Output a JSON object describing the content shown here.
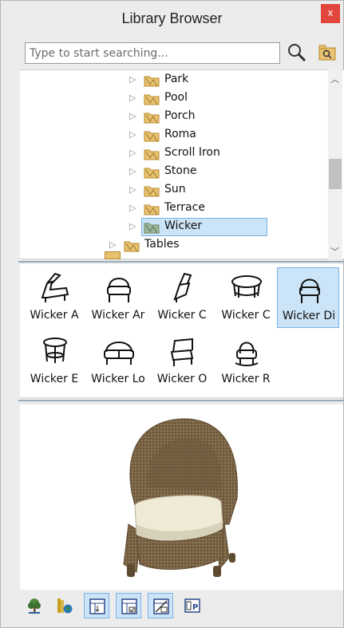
{
  "window": {
    "title": "Library Browser",
    "close_label": "x"
  },
  "search": {
    "placeholder": "Type to start searching...",
    "value": ""
  },
  "tree": {
    "items": [
      {
        "label": "Park"
      },
      {
        "label": "Pool"
      },
      {
        "label": "Porch"
      },
      {
        "label": "Roma"
      },
      {
        "label": "Scroll Iron"
      },
      {
        "label": "Stone"
      },
      {
        "label": "Sun"
      },
      {
        "label": "Terrace"
      },
      {
        "label": "Wicker",
        "selected": true
      }
    ],
    "parent_item": {
      "label": "Tables"
    }
  },
  "thumbnails": [
    {
      "label": "Wicker A"
    },
    {
      "label": "Wicker Ar"
    },
    {
      "label": "Wicker C"
    },
    {
      "label": "Wicker C"
    },
    {
      "label": "Wicker Di",
      "selected": true
    },
    {
      "label": "Wicker E"
    },
    {
      "label": "Wicker Lo"
    },
    {
      "label": "Wicker O"
    },
    {
      "label": "Wicker R"
    }
  ],
  "colors": {
    "selection": "#cce4f7",
    "selection_border": "#7ab3e6",
    "close": "#e0463b",
    "folder": "#e8c270"
  },
  "icons": [
    "search-icon",
    "find-folder-icon",
    "tree-icon",
    "books-globe-icon",
    "view-options-icon"
  ]
}
